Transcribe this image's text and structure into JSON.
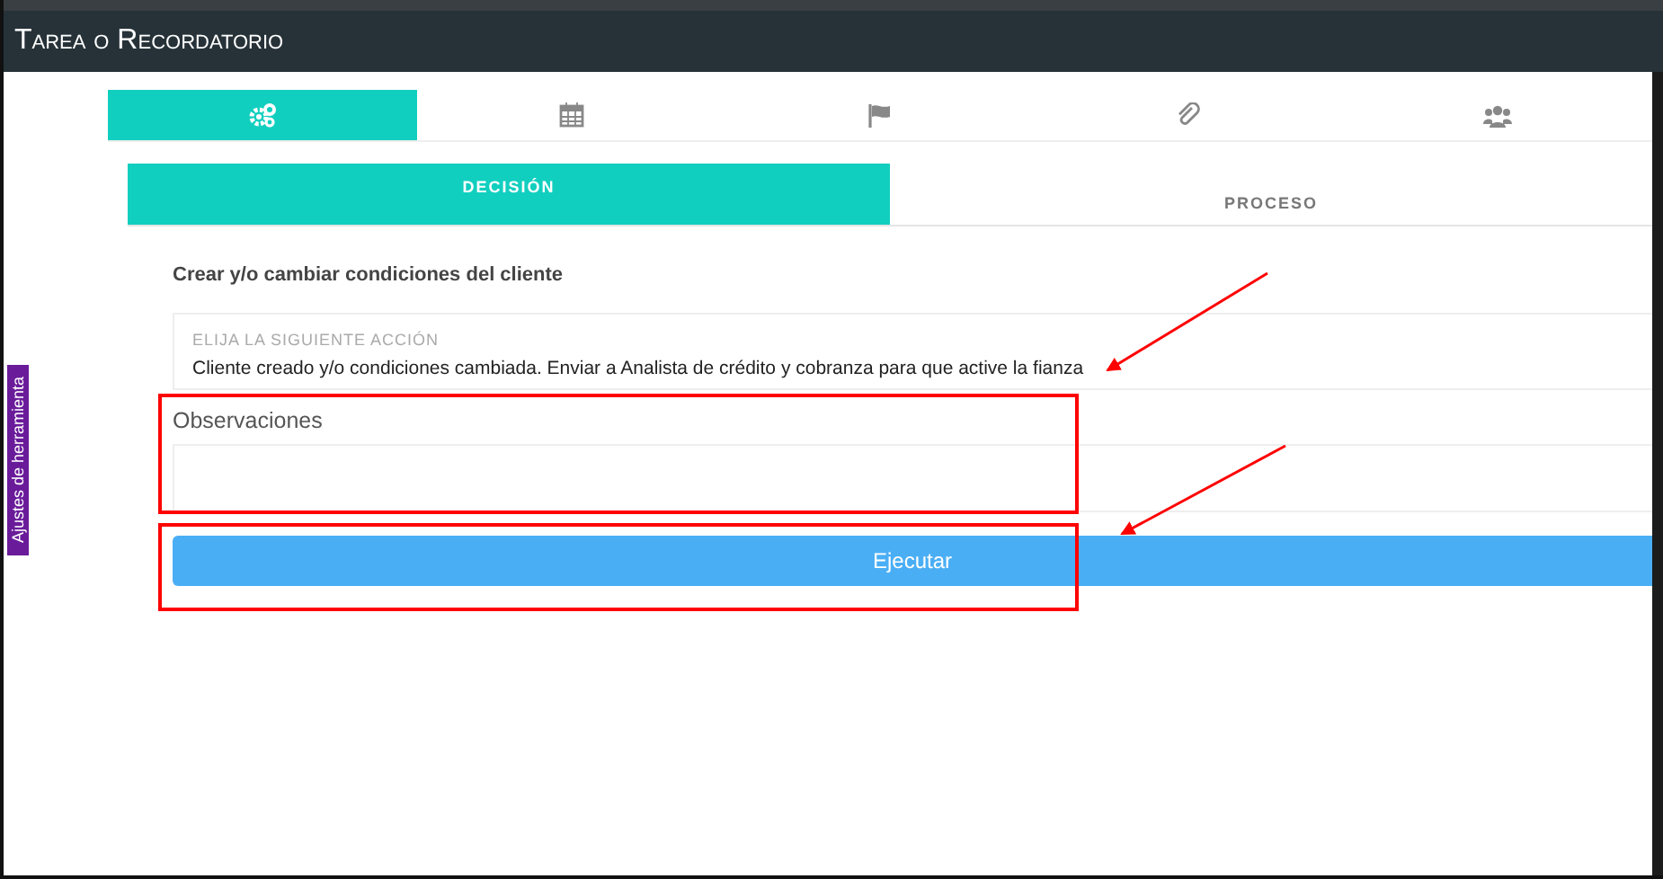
{
  "window": {
    "title": "Tarea o Recordatorio"
  },
  "icon_tabs": [
    {
      "kind": "gears",
      "selected": true
    },
    {
      "kind": "calendar",
      "selected": false
    },
    {
      "kind": "flag",
      "selected": false
    },
    {
      "kind": "paperclip",
      "selected": false
    },
    {
      "kind": "users",
      "selected": false
    }
  ],
  "section_tabs": [
    {
      "label": "DECISIÓN",
      "selected": true
    },
    {
      "label": "PROCESO",
      "selected": false
    }
  ],
  "heading": "Crear y/o cambiar condiciones del cliente",
  "action_select": {
    "label": "ELIJA LA SIGUIENTE ACCIÓN",
    "value": "Cliente creado y/o condiciones cambiada. Enviar a Analista de crédito y cobranza para que active la fianza"
  },
  "observations": {
    "label": "Observaciones"
  },
  "button": "Ejecutar",
  "side_tab": "Ajustes de herramienta"
}
